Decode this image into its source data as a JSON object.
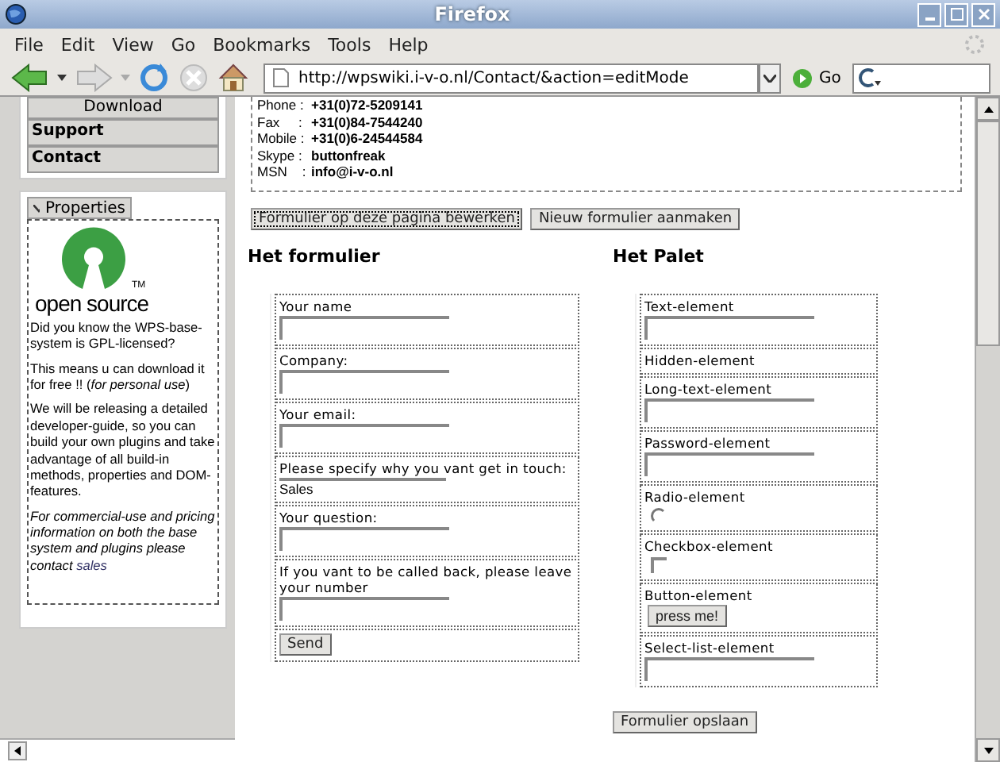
{
  "window": {
    "title": "Firefox"
  },
  "menu": [
    "File",
    "Edit",
    "View",
    "Go",
    "Bookmarks",
    "Tools",
    "Help"
  ],
  "toolbar": {
    "url": "http://wpswiki.i-v-o.nl/Contact/&action=editMode",
    "go": "Go"
  },
  "sidebar": {
    "nav": [
      {
        "label": "Download"
      },
      {
        "label": "Support"
      },
      {
        "label": "Contact"
      }
    ],
    "panel_title": "Properties",
    "logo_text": "open source",
    "logo_tm": "TM",
    "paragraphs": [
      {
        "text": "Did you know the WPS-base-system is GPL-licensed?",
        "italic": false
      },
      {
        "text": "This means u can download it for free !! (*for personal use*)",
        "italic": false
      },
      {
        "text": "We will be releasing a detailed developer-guide, so you can build your own plugins and take advantage of all build-in methods, properties and DOM-features.",
        "italic": false
      },
      {
        "text": "For commercial-use and pricing information on both the base system and plugins  please contact",
        "italic": true,
        "link": "sales"
      }
    ]
  },
  "contact": [
    {
      "label": "Phone :",
      "value": "+31(0)72-5209141"
    },
    {
      "label": "Fax     :",
      "value": "+31(0)84-7544240"
    },
    {
      "label": "Mobile :",
      "value": "+31(0)6-24544584"
    },
    {
      "label": "Skype :",
      "value": "buttonfreak"
    },
    {
      "label": "MSN    :",
      "value": "info@i-v-o.nl"
    }
  ],
  "action_buttons": [
    {
      "label": "Formulier op deze pagina bewerken",
      "selected": true
    },
    {
      "label": "Nieuw formulier aanmaken",
      "selected": false
    }
  ],
  "form": {
    "title": "Het formulier",
    "fields": [
      {
        "label": "Your name"
      },
      {
        "label": "Company:"
      },
      {
        "label": "Your email:"
      },
      {
        "label": "Please specify why you vant get in touch:",
        "value": "Sales"
      },
      {
        "label": "Your question:"
      },
      {
        "label": "If you vant to be called back, please leave your number"
      }
    ],
    "submit": "Send"
  },
  "palette": {
    "title": "Het Palet",
    "elements": [
      {
        "label": "Text-element",
        "kind": "text"
      },
      {
        "label": "Hidden-element",
        "kind": "hidden"
      },
      {
        "label": "Long-text-element",
        "kind": "text"
      },
      {
        "label": "Password-element",
        "kind": "text"
      },
      {
        "label": "Radio-element",
        "kind": "radio",
        "checked": false
      },
      {
        "label": "Checkbox-element",
        "kind": "checkbox",
        "checked": false
      },
      {
        "label": "Button-element",
        "kind": "button",
        "button": "press me!"
      },
      {
        "label": "Select-list-element",
        "kind": "text"
      }
    ]
  },
  "save_button": "Formulier opslaan"
}
